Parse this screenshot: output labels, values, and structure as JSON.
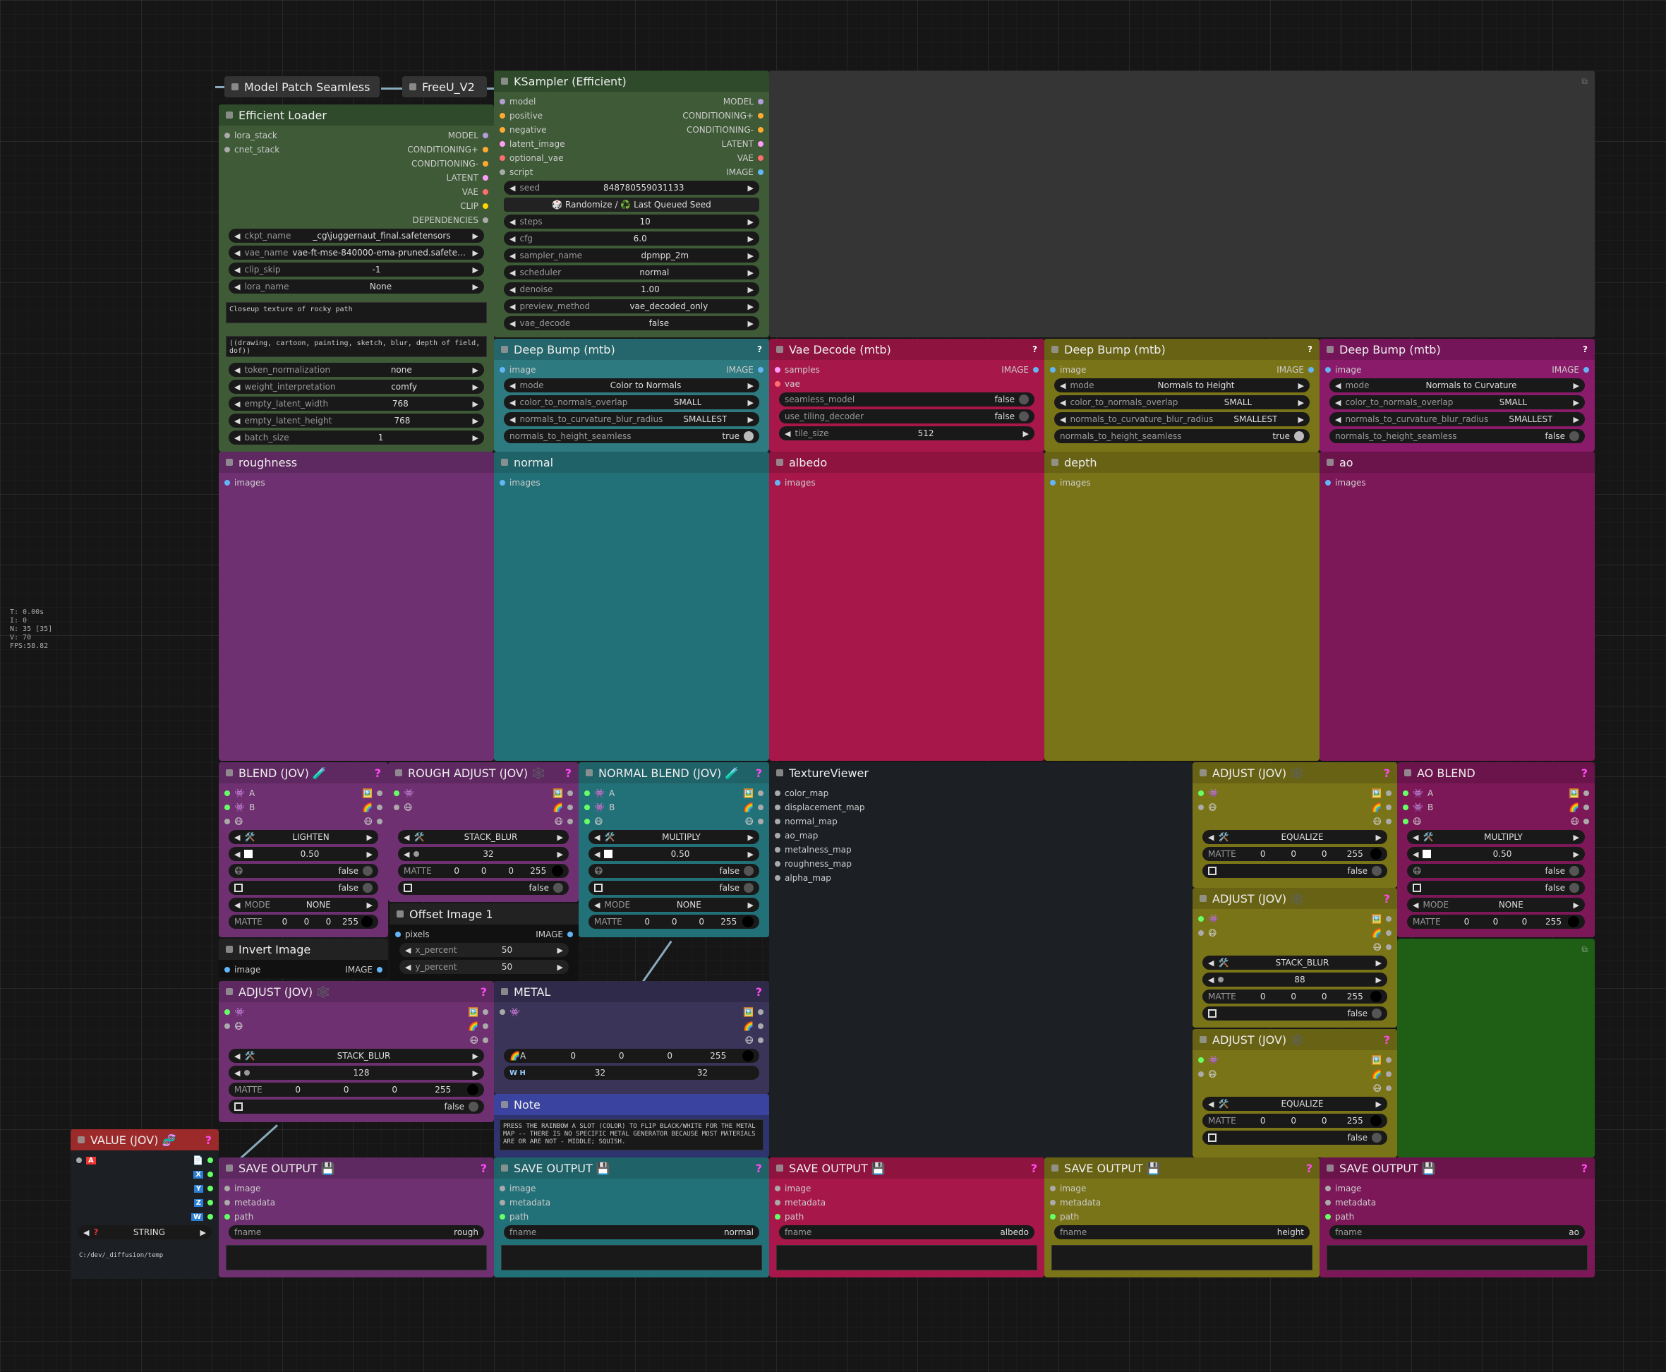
{
  "stats": [
    "T: 0.00s",
    "I: 0",
    "N: 35 [35]",
    "V: 70",
    "FPS:58.82"
  ],
  "patch": {
    "title": "Model Patch Seamless"
  },
  "freeu": {
    "title": "FreeU_V2"
  },
  "loader": {
    "title": "Efficient Loader",
    "inputs": [
      "lora_stack",
      "cnet_stack"
    ],
    "outputs": [
      "MODEL",
      "CONDITIONING+",
      "CONDITIONING-",
      "LATENT",
      "VAE",
      "CLIP",
      "DEPENDENCIES"
    ],
    "widgets": [
      {
        "k": "ckpt_name",
        "v": "_cg\\juggernaut_final.safetensors"
      },
      {
        "k": "vae_name",
        "v": "vae-ft-mse-840000-ema-pruned.safetensors"
      },
      {
        "k": "clip_skip",
        "v": "-1"
      },
      {
        "k": "lora_name",
        "v": "None"
      }
    ],
    "positive": "Closeup texture of rocky path",
    "negative": "((drawing, cartoon, painting, sketch, blur, depth of field, dof))",
    "widgets2": [
      {
        "k": "token_normalization",
        "v": "none"
      },
      {
        "k": "weight_interpretation",
        "v": "comfy"
      },
      {
        "k": "empty_latent_width",
        "v": "768"
      },
      {
        "k": "empty_latent_height",
        "v": "768"
      },
      {
        "k": "batch_size",
        "v": "1"
      }
    ]
  },
  "ksampler": {
    "title": "KSampler (Efficient)",
    "inputs": [
      "model",
      "positive",
      "negative",
      "latent_image",
      "optional_vae",
      "script"
    ],
    "outputs": [
      "MODEL",
      "CONDITIONING+",
      "CONDITIONING-",
      "LATENT",
      "VAE",
      "IMAGE"
    ],
    "seed": {
      "k": "seed",
      "v": "848780559031133"
    },
    "seed_btn": "🎲 Randomize / ♻️ Last Queued Seed",
    "widgets": [
      {
        "k": "steps",
        "v": "10"
      },
      {
        "k": "cfg",
        "v": "6.0"
      },
      {
        "k": "sampler_name",
        "v": "dpmpp_2m"
      },
      {
        "k": "scheduler",
        "v": "normal"
      },
      {
        "k": "denoise",
        "v": "1.00"
      },
      {
        "k": "preview_method",
        "v": "vae_decoded_only"
      },
      {
        "k": "vae_decode",
        "v": "false"
      }
    ]
  },
  "deepbump1": {
    "title": "Deep Bump (mtb)",
    "in": "image",
    "out": "IMAGE",
    "widgets": [
      {
        "k": "mode",
        "v": "Color to Normals"
      },
      {
        "k": "color_to_normals_overlap",
        "v": "SMALL"
      },
      {
        "k": "normals_to_curvature_blur_radius",
        "v": "SMALLEST"
      }
    ],
    "toggle": {
      "k": "normals_to_height_seamless",
      "v": "true"
    }
  },
  "vaedecode": {
    "title": "Vae Decode (mtb)",
    "inputs": [
      "samples",
      "vae"
    ],
    "out": "IMAGE",
    "toggles": [
      {
        "k": "seamless_model",
        "v": "false"
      },
      {
        "k": "use_tiling_decoder",
        "v": "false"
      }
    ],
    "tile": {
      "k": "tile_size",
      "v": "512"
    }
  },
  "deepbump2": {
    "title": "Deep Bump (mtb)",
    "in": "image",
    "out": "IMAGE",
    "widgets": [
      {
        "k": "mode",
        "v": "Normals to Height"
      },
      {
        "k": "color_to_normals_overlap",
        "v": "SMALL"
      },
      {
        "k": "normals_to_curvature_blur_radius",
        "v": "SMALLEST"
      }
    ],
    "toggle": {
      "k": "normals_to_height_seamless",
      "v": "true"
    }
  },
  "deepbump3": {
    "title": "Deep Bump (mtb)",
    "in": "image",
    "out": "IMAGE",
    "widgets": [
      {
        "k": "mode",
        "v": "Normals to Curvature"
      },
      {
        "k": "color_to_normals_overlap",
        "v": "SMALL"
      },
      {
        "k": "normals_to_curvature_blur_radius",
        "v": "SMALLEST"
      }
    ],
    "toggle": {
      "k": "normals_to_height_seamless",
      "v": "false"
    }
  },
  "previews": [
    {
      "title": "roughness",
      "in": "images"
    },
    {
      "title": "normal",
      "in": "images"
    },
    {
      "title": "albedo",
      "in": "images"
    },
    {
      "title": "depth",
      "in": "images"
    },
    {
      "title": "ao",
      "in": "images"
    }
  ],
  "blend": {
    "title": "BLEND (JOV) 🧪",
    "A": "A",
    "B": "B",
    "op": "LIGHTEN",
    "alpha": "0.50",
    "f1": "false",
    "f2": "false",
    "mode_k": "MODE",
    "mode_v": "NONE",
    "matte": "MATTE",
    "m": [
      "0",
      "0",
      "0",
      "255"
    ]
  },
  "rough": {
    "title": "ROUGH ADJUST (JOV) 🕸️",
    "op": "STACK_BLUR",
    "r": "32",
    "matte": "MATTE",
    "m": [
      "0",
      "0",
      "0",
      "255"
    ],
    "f": "false"
  },
  "nblend": {
    "title": "NORMAL BLEND (JOV) 🧪",
    "A": "A",
    "B": "B",
    "op": "MULTIPLY",
    "alpha": "0.50",
    "f1": "false",
    "f2": "false",
    "mode_k": "MODE",
    "mode_v": "NONE",
    "matte": "MATTE",
    "m": [
      "0",
      "0",
      "0",
      "255"
    ]
  },
  "texview": {
    "title": "TextureViewer",
    "inputs": [
      "color_map",
      "displacement_map",
      "normal_map",
      "ao_map",
      "metalness_map",
      "roughness_map",
      "alpha_map"
    ]
  },
  "adj1": {
    "title": "ADJUST (JOV) 🕸️",
    "op": "EQUALIZE",
    "matte": "MATTE",
    "m": [
      "0",
      "0",
      "0",
      "255"
    ],
    "f": "false"
  },
  "adj2": {
    "title": "ADJUST (JOV) 🕸️",
    "op": "STACK_BLUR",
    "r": "88",
    "matte": "MATTE",
    "m": [
      "0",
      "0",
      "0",
      "255"
    ],
    "f": "false"
  },
  "adj3": {
    "title": "ADJUST (JOV) 🕸️",
    "op": "EQUALIZE",
    "matte": "MATTE",
    "m": [
      "0",
      "0",
      "0",
      "255"
    ],
    "f": "false"
  },
  "aoblend": {
    "title": "AO BLEND",
    "A": "A",
    "B": "B",
    "op": "MULTIPLY",
    "alpha": "0.50",
    "f1": "false",
    "f2": "false",
    "mode_k": "MODE",
    "mode_v": "NONE",
    "matte": "MATTE",
    "m": [
      "0",
      "0",
      "0",
      "255"
    ]
  },
  "offset": {
    "title": "Offset Image 1",
    "in": "pixels",
    "out": "IMAGE",
    "x": {
      "k": "x_percent",
      "v": "50"
    },
    "y": {
      "k": "y_percent",
      "v": "50"
    }
  },
  "invert": {
    "title": "Invert Image",
    "in": "image",
    "out": "IMAGE"
  },
  "adj4": {
    "title": "ADJUST (JOV) 🕸️",
    "op": "STACK_BLUR",
    "r": "128",
    "matte": "MATTE",
    "m": [
      "0",
      "0",
      "0",
      "255"
    ],
    "f": "false"
  },
  "metal": {
    "title": "METAL",
    "a": "A",
    "c": [
      "0",
      "0",
      "0",
      "255"
    ],
    "wh": "W H",
    "w": "32",
    "h": "32"
  },
  "note": {
    "title": "Note",
    "text": "PRESS THE RAINBOW A SLOT (COLOR) TO FLIP BLACK/WHITE FOR THE METAL MAP -- THERE IS NO SPECIFIC METAL GENERATOR BECAUSE MOST MATERIALS ARE OR ARE NOT - MIDDLE; SQUISH."
  },
  "value": {
    "title": "VALUE (JOV) 🧬",
    "ports": [
      "X",
      "Y",
      "Z",
      "W"
    ],
    "type": "STRING",
    "path": "C:/dev/_diffusion/temp"
  },
  "saves": [
    {
      "title": "SAVE OUTPUT 💾",
      "fname": "rough"
    },
    {
      "title": "SAVE OUTPUT 💾",
      "fname": "normal"
    },
    {
      "title": "SAVE OUTPUT 💾",
      "fname": "albedo"
    },
    {
      "title": "SAVE OUTPUT 💾",
      "fname": "height"
    },
    {
      "title": "SAVE OUTPUT 💾",
      "fname": "ao"
    }
  ],
  "save_inputs": [
    "image",
    "metadata",
    "path"
  ],
  "fname_label": "fname"
}
